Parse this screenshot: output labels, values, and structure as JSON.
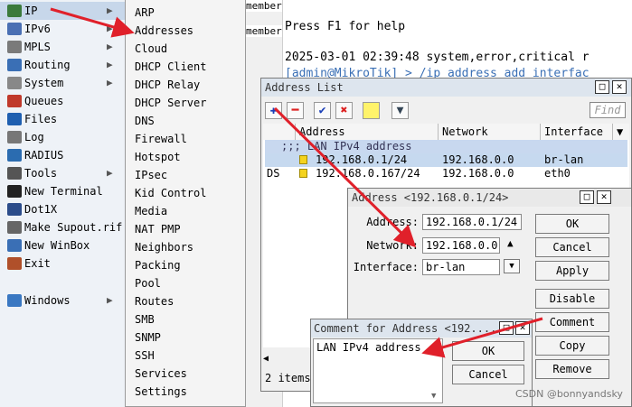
{
  "terminal": {
    "help": "Press F1 for help",
    "log": "2025-03-01 02:39:48 system,error,critical r",
    "prompt": "[admin@MikroTik] > /ip address add interfac",
    "member1": "member",
    "member2": "member"
  },
  "left_menu": {
    "items": [
      {
        "label": "IP",
        "icon": "ip-icon",
        "arrow": true
      },
      {
        "label": "IPv6",
        "icon": "ipv6-icon",
        "arrow": true
      },
      {
        "label": "MPLS",
        "icon": "mpls-icon",
        "arrow": true
      },
      {
        "label": "Routing",
        "icon": "routing-icon",
        "arrow": true
      },
      {
        "label": "System",
        "icon": "system-icon",
        "arrow": true
      },
      {
        "label": "Queues",
        "icon": "queues-icon",
        "arrow": false
      },
      {
        "label": "Files",
        "icon": "files-icon",
        "arrow": false
      },
      {
        "label": "Log",
        "icon": "log-icon",
        "arrow": false
      },
      {
        "label": "RADIUS",
        "icon": "radius-icon",
        "arrow": false
      },
      {
        "label": "Tools",
        "icon": "tools-icon",
        "arrow": true
      },
      {
        "label": "New Terminal",
        "icon": "terminal-icon",
        "arrow": false
      },
      {
        "label": "Dot1X",
        "icon": "dot1x-icon",
        "arrow": false
      },
      {
        "label": "Make Supout.rif",
        "icon": "supout-icon",
        "arrow": false
      },
      {
        "label": "New WinBox",
        "icon": "winbox-icon",
        "arrow": false
      },
      {
        "label": "Exit",
        "icon": "exit-icon",
        "arrow": false
      },
      {
        "label": "Windows",
        "icon": "windows-icon",
        "arrow": true
      }
    ]
  },
  "submenu": {
    "items": [
      "ARP",
      "Addresses",
      "Cloud",
      "DHCP Client",
      "DHCP Relay",
      "DHCP Server",
      "DNS",
      "Firewall",
      "Hotspot",
      "IPsec",
      "Kid Control",
      "Media",
      "NAT PMP",
      "Neighbors",
      "Packing",
      "Pool",
      "Routes",
      "SMB",
      "SNMP",
      "SSH",
      "Services",
      "Settings"
    ]
  },
  "address_list": {
    "title": "Address List",
    "find": "Find",
    "columns": [
      "Address",
      "Network",
      "Interface"
    ],
    "group_row": ";;; LAN IPv4 address",
    "rows": [
      {
        "flag": "",
        "address": "192.168.0.1/24",
        "network": "192.168.0.0",
        "interface": "br-lan"
      },
      {
        "flag": "DS",
        "address": "192.168.0.167/24",
        "network": "192.168.0.0",
        "interface": "eth0"
      }
    ],
    "status": "2 items"
  },
  "address_detail": {
    "title": "Address <192.168.0.1/24>",
    "labels": {
      "address": "Address:",
      "network": "Network:",
      "interface": "Interface:"
    },
    "values": {
      "address": "192.168.0.1/24",
      "network": "192.168.0.0",
      "interface": "br-lan"
    },
    "buttons": {
      "ok": "OK",
      "cancel": "Cancel",
      "apply": "Apply",
      "disable": "Disable",
      "comment": "Comment",
      "copy": "Copy",
      "remove": "Remove"
    }
  },
  "comment_window": {
    "title": "Comment for Address <192....",
    "text": "LAN IPv4 address",
    "buttons": {
      "ok": "OK",
      "cancel": "Cancel"
    }
  },
  "watermark": "CSDN @bonnyandsky",
  "colors": {
    "arrow": "#e0202a",
    "menu_bg": "#eef2f7",
    "selection": "#c7d7ea",
    "row_highlight": "#c6d9ef",
    "group_row": "#c8d8ef"
  }
}
